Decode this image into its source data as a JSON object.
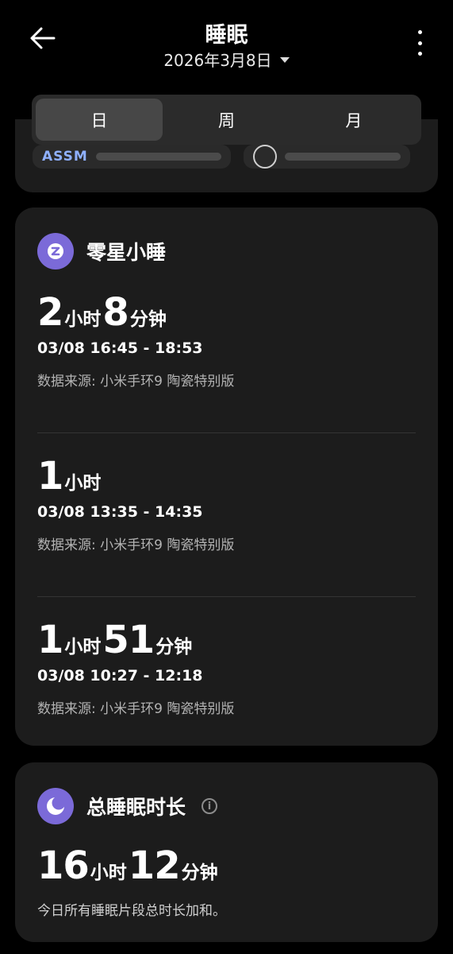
{
  "header": {
    "title": "睡眠",
    "date": "2026年3月8日"
  },
  "tabs": [
    {
      "label": "日",
      "active": true
    },
    {
      "label": "周",
      "active": false
    },
    {
      "label": "月",
      "active": false
    }
  ],
  "partner_logos": {
    "left_mark": "ASSM"
  },
  "naps_card": {
    "title": "零星小睡",
    "icon": "nap-z-icon",
    "entries": [
      {
        "h": "2",
        "h_unit": "小时",
        "m": "8",
        "m_unit": "分钟",
        "range": "03/08 16:45 - 18:53",
        "source": "数据来源: 小米手环9 陶瓷特别版"
      },
      {
        "h": "1",
        "h_unit": "小时",
        "range": "03/08 13:35 - 14:35",
        "source": "数据来源: 小米手环9 陶瓷特别版"
      },
      {
        "h": "1",
        "h_unit": "小时",
        "m": "51",
        "m_unit": "分钟",
        "range": "03/08 10:27 - 12:18",
        "source": "数据来源: 小米手环9 陶瓷特别版"
      }
    ]
  },
  "total_card": {
    "title": "总睡眠时长",
    "icon": "moon-icon",
    "info_icon": "info-icon",
    "h": "16",
    "h_unit": "小时",
    "m": "12",
    "m_unit": "分钟",
    "description": "今日所有睡眠片段总时长加和。"
  },
  "colors": {
    "accent": "#7b6ad8",
    "card": "#1c1c1c",
    "background": "#000000"
  }
}
